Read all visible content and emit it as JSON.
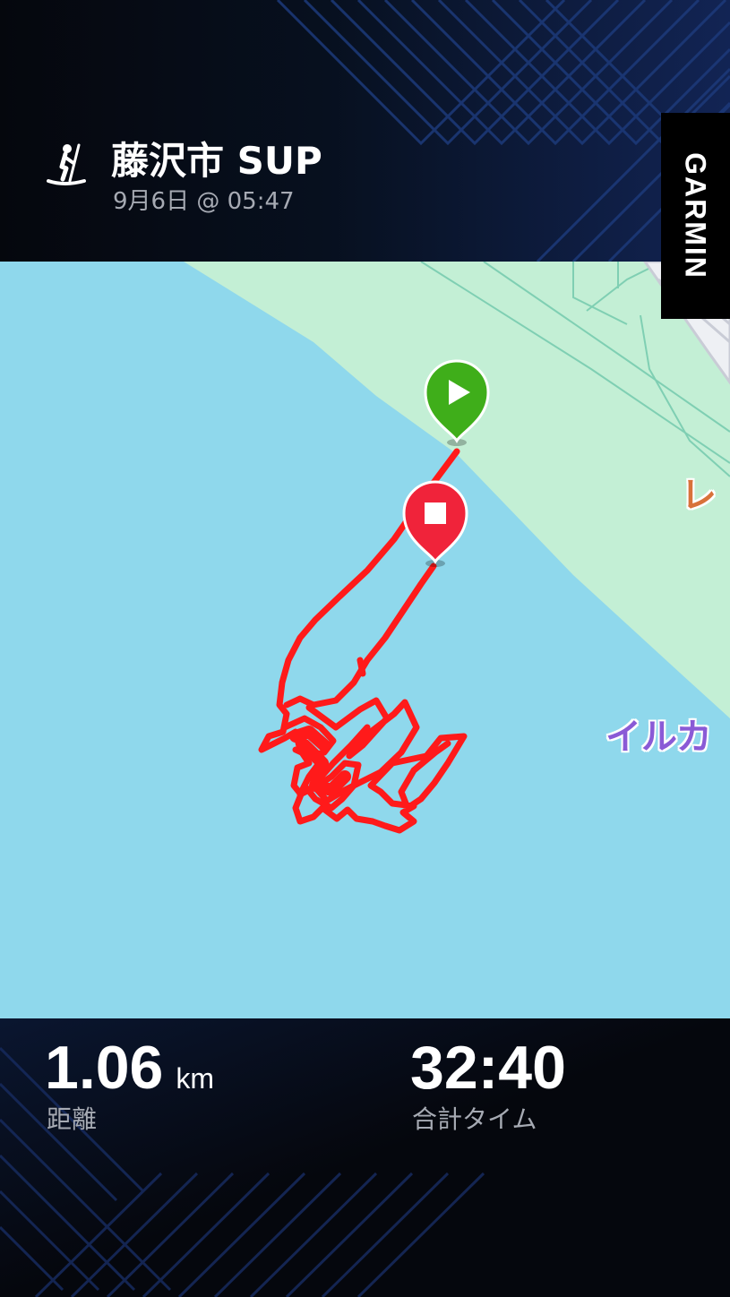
{
  "activity": {
    "icon": "sup-paddleboard-icon",
    "title": "藤沢市 SUP",
    "datetime": "9月6日 @ 05:47"
  },
  "brand": {
    "name": "GARMIN"
  },
  "map": {
    "labels": {
      "place_1": "レ",
      "place_2": "イルカ"
    },
    "start_marker": "start-marker-icon",
    "end_marker": "end-marker-icon",
    "colors": {
      "water": "#8fd8ec",
      "land": "#c3efd5",
      "track": "#ff1a1a",
      "start": "#3fae1a",
      "end": "#f0233a"
    }
  },
  "stats": {
    "distance": {
      "value": "1.06",
      "unit": "km",
      "label": "距離"
    },
    "time": {
      "value": "32:40",
      "label": "合計タイム"
    }
  }
}
